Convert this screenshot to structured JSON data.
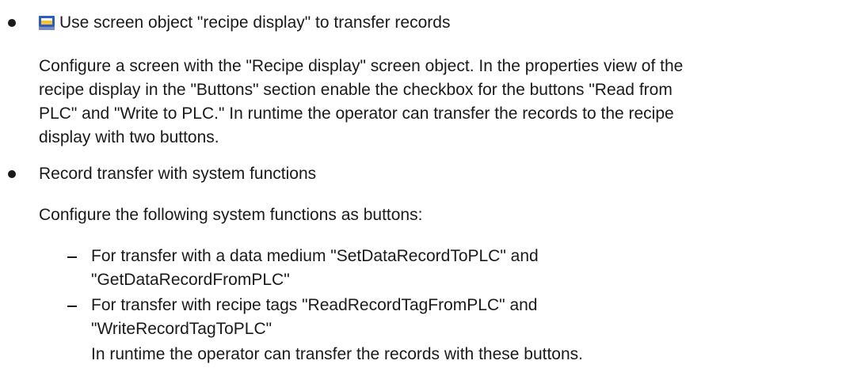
{
  "items": [
    {
      "icon": "screen-object-icon",
      "heading": "Use screen object \"recipe display\" to transfer records",
      "lines": [
        "Configure a screen with the \"Recipe display\" screen object. In the properties view of the",
        "recipe display in the \"Buttons\" section enable the checkbox for the buttons \"Read from",
        "PLC\" and \"Write to PLC.\" In runtime the operator can transfer the records to the recipe",
        "display with two buttons."
      ]
    },
    {
      "heading": "Record transfer with system functions",
      "intro": "Configure the following system functions as buttons:",
      "subitems": [
        {
          "lines": [
            "For transfer with a data medium \"SetDataRecordToPLC\" and",
            "\"GetDataRecordFromPLC\""
          ]
        },
        {
          "lines": [
            "For transfer with recipe tags \"ReadRecordTagFromPLC\" and",
            "\"WriteRecordTagToPLC\""
          ]
        }
      ],
      "closing": "In runtime the operator can transfer the records with these buttons."
    }
  ]
}
